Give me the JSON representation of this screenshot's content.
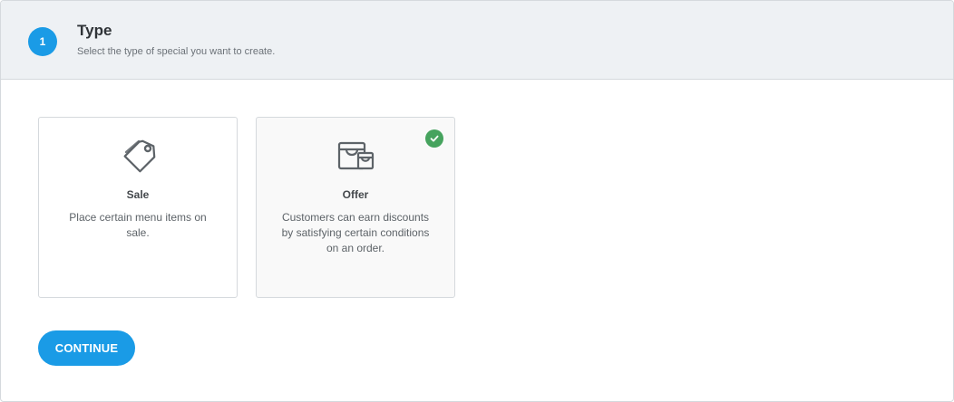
{
  "step": {
    "number": "1",
    "title": "Type",
    "subtitle": "Select the type of special you want to create."
  },
  "options": [
    {
      "id": "sale",
      "title": "Sale",
      "description": "Place certain menu items on sale.",
      "icon": "price-tag-icon",
      "selected": false
    },
    {
      "id": "offer",
      "title": "Offer",
      "description": "Customers can earn discounts by satisfying certain conditions on an order.",
      "icon": "shopping-bags-icon",
      "selected": true
    }
  ],
  "actions": {
    "continue_label": "CONTINUE"
  },
  "colors": {
    "accent": "#1a9be6",
    "success": "#46a35e",
    "header_bg": "#eef1f4"
  }
}
